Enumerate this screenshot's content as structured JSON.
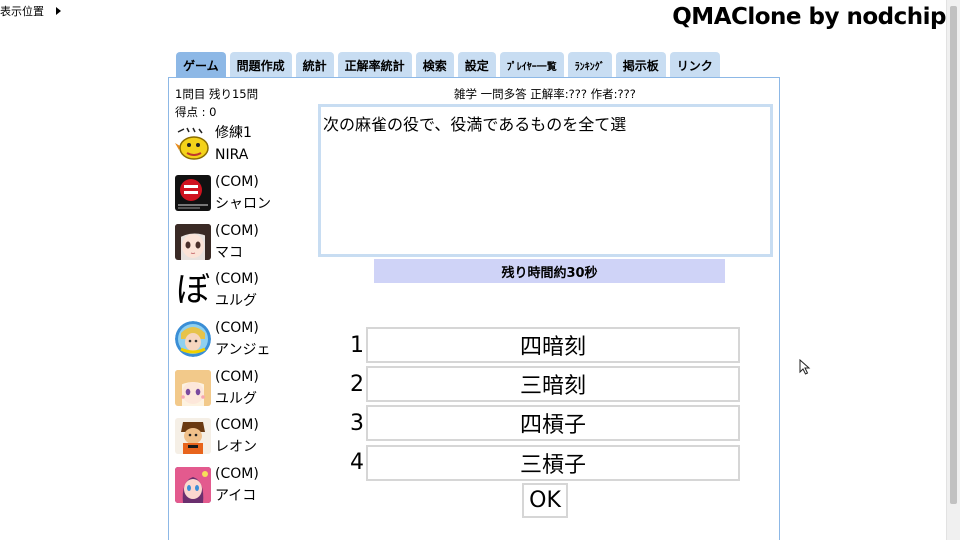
{
  "position_toggle": {
    "label": "表示位置"
  },
  "brand": {
    "title": "QMAClone by nodchip"
  },
  "tabs": [
    {
      "label": "ゲーム",
      "active": true
    },
    {
      "label": "問題作成"
    },
    {
      "label": "統計"
    },
    {
      "label": "正解率統計"
    },
    {
      "label": "検索"
    },
    {
      "label": "設定"
    },
    {
      "label": "ﾌﾟﾚｲﾔｰ一覧"
    },
    {
      "label": "ﾗﾝｷﾝｸﾞ"
    },
    {
      "label": "掲示板"
    },
    {
      "label": "リンク"
    }
  ],
  "game": {
    "progress": "1問目 残り15問",
    "score": "得点 : 0",
    "meta": "雑学 一問多答 正解率:??? 作者:???",
    "question": "次の麻雀の役で、役満であるものを全て選",
    "timer": "残り時間約30秒",
    "ok_label": "OK"
  },
  "players": [
    {
      "line1": "修練1",
      "line2": "NIRA",
      "avatar": "yellow-bird-avatar"
    },
    {
      "line1": "(COM)",
      "line2": "シャロン",
      "avatar": "red-badge-avatar"
    },
    {
      "line1": "(COM)",
      "line2": "マコ",
      "avatar": "anime-girl-avatar"
    },
    {
      "line1": "(COM)",
      "line2": "ユルグ",
      "avatar": "kana-bo-avatar",
      "avatar_char": "ぼ"
    },
    {
      "line1": "(COM)",
      "line2": "アンジェ",
      "avatar": "round-portrait-avatar"
    },
    {
      "line1": "(COM)",
      "line2": "ユルグ",
      "avatar": "blonde-girl-avatar"
    },
    {
      "line1": "(COM)",
      "line2": "レオン",
      "avatar": "warrior-avatar"
    },
    {
      "line1": "(COM)",
      "line2": "アイコ",
      "avatar": "pink-hair-avatar"
    }
  ],
  "choices": [
    {
      "number": "1",
      "label": "四暗刻"
    },
    {
      "number": "2",
      "label": "三暗刻"
    },
    {
      "number": "3",
      "label": "四槓子"
    },
    {
      "number": "4",
      "label": "三槓子"
    }
  ]
}
